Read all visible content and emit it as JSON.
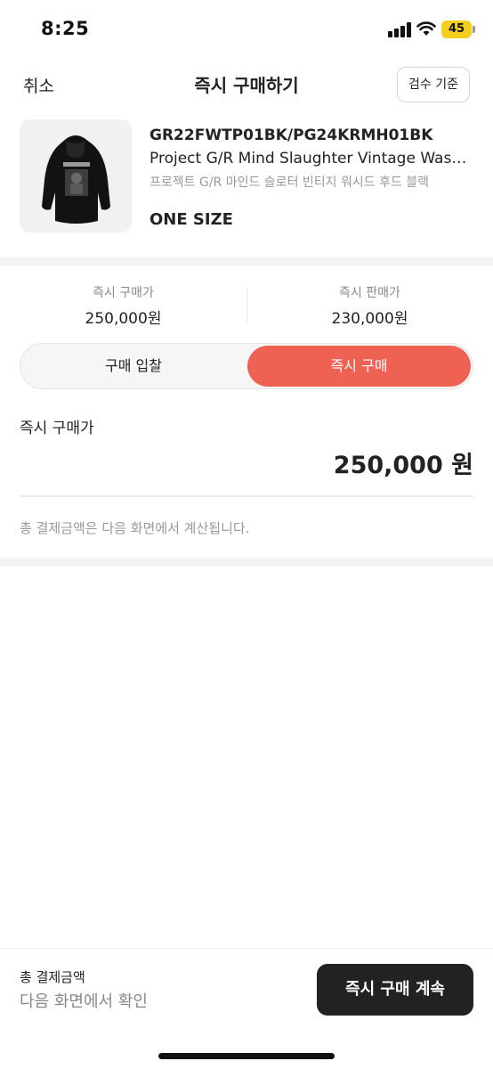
{
  "status_bar": {
    "time": "8:25",
    "battery": "45",
    "battery_color": "#f5cf1e"
  },
  "header": {
    "cancel": "취소",
    "title": "즉시 구매하기",
    "inspection_button": "검수 기준"
  },
  "product": {
    "image_icon": "hoodie-product-image",
    "code": "GR22FWTP01BK/PG24KRMH01BK",
    "name_en": "Project G/R Mind Slaughter Vintage Washed Hood Black",
    "name_ko": "프로젝트 G/R 마인드 슬로터 빈티지 워시드 후드 블랙",
    "size": "ONE SIZE"
  },
  "prices": {
    "instant_buy_label": "즉시 구매가",
    "instant_buy_value": "250,000원",
    "instant_sell_label": "즉시 판매가",
    "instant_sell_value": "230,000원"
  },
  "tabs": {
    "bid": "구매 입찰",
    "buy_now": "즉시 구매",
    "selected": "buy_now",
    "accent_color": "#ef6253"
  },
  "price_section": {
    "label": "즉시 구매가",
    "value": "250,000 원",
    "notice": "총 결제금액은 다음 화면에서 계산됩니다."
  },
  "bottom_bar": {
    "total_label": "총 결제금액",
    "total_sub": "다음 화면에서 확인",
    "cta": "즉시 구매 계속"
  }
}
